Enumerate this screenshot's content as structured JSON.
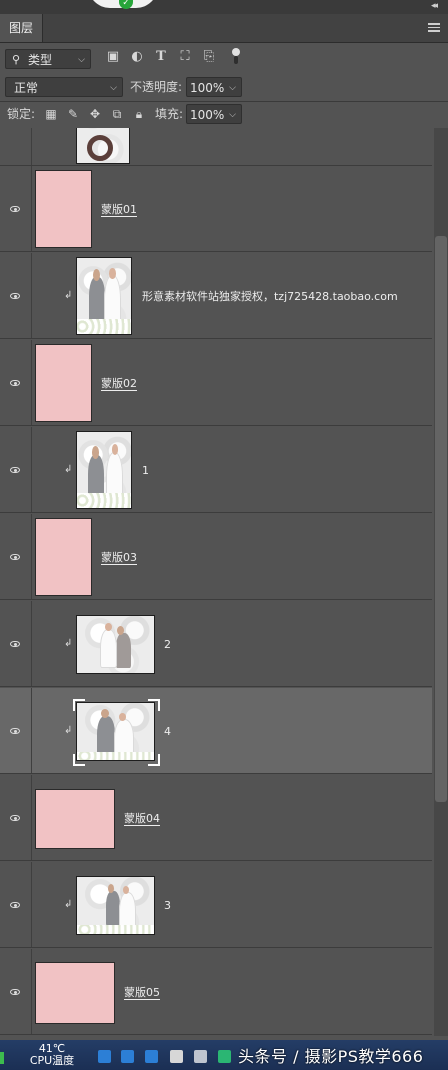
{
  "panel": {
    "tab_label": "图层",
    "filter_label": "类型",
    "blend_mode": "正常",
    "opacity_label": "不透明度:",
    "opacity_value": "100%",
    "lock_label": "锁定:",
    "fill_label": "填充:",
    "fill_value": "100%"
  },
  "layers": [
    {
      "name": "",
      "kind": "photo",
      "visible": true,
      "clipped": false
    },
    {
      "name": "蒙版01",
      "kind": "mask",
      "visible": true
    },
    {
      "name": "形意素材软件站独家授权，tzj725428.taobao.com",
      "kind": "photo",
      "visible": true,
      "clipped": true
    },
    {
      "name": "蒙版02",
      "kind": "mask",
      "visible": true
    },
    {
      "name": "1",
      "kind": "photo",
      "visible": true,
      "clipped": true
    },
    {
      "name": "蒙版03",
      "kind": "mask",
      "visible": true
    },
    {
      "name": "2",
      "kind": "photo",
      "visible": true,
      "clipped": true
    },
    {
      "name": "4",
      "kind": "photo",
      "visible": true,
      "clipped": true,
      "selected": true
    },
    {
      "name": "蒙版04",
      "kind": "mask",
      "visible": true
    },
    {
      "name": "3",
      "kind": "photo",
      "visible": true,
      "clipped": true
    },
    {
      "name": "蒙版05",
      "kind": "mask",
      "visible": true
    }
  ],
  "taskbar": {
    "temperature": "41℃",
    "temp_label": "CPU温度",
    "watermark": "头条号 / 摄影PS教学666"
  },
  "colors": {
    "panel_bg": "#535353",
    "mask_fill": "#f1c2c4",
    "selected_row": "#686868",
    "taskbar": "#1b2f54"
  }
}
